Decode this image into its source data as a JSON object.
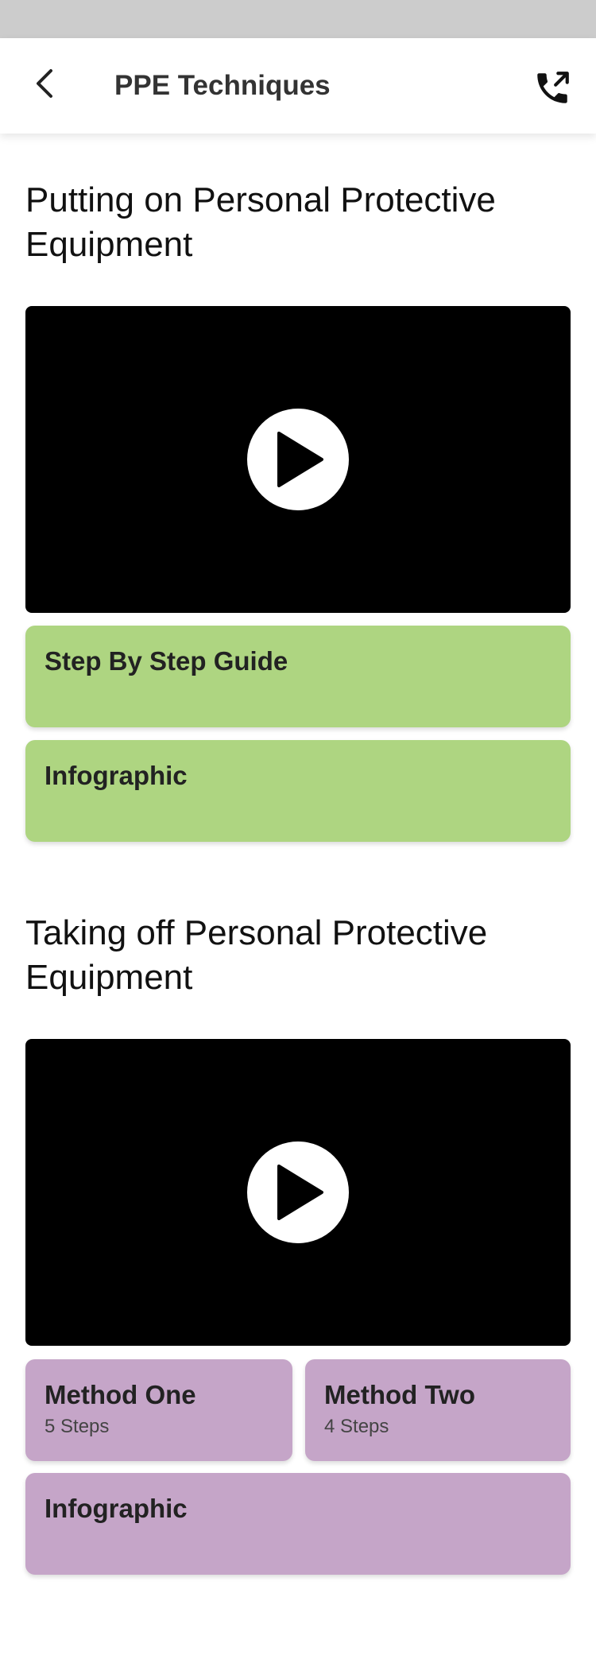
{
  "header": {
    "title": "PPE Techniques",
    "back_icon": "chevron-left-icon",
    "call_icon": "phone-outgoing-icon"
  },
  "sections": [
    {
      "title": "Putting on Personal Protective Equipment",
      "video": {
        "play_icon": "play-icon"
      },
      "cards": [
        {
          "title": "Step By Step Guide",
          "subtitle": ""
        },
        {
          "title": "Infographic",
          "subtitle": ""
        }
      ],
      "accent": "#aed581"
    },
    {
      "title": "Taking off Personal Protective Equipment",
      "video": {
        "play_icon": "play-icon"
      },
      "cards": [
        {
          "title": "Method One",
          "subtitle": "5 Steps"
        },
        {
          "title": "Method Two",
          "subtitle": "4 Steps"
        },
        {
          "title": "Infographic",
          "subtitle": ""
        }
      ],
      "accent": "#c5a5c8"
    }
  ],
  "colors": {
    "status_bar": "#cccccc",
    "video_bg": "#000000"
  }
}
